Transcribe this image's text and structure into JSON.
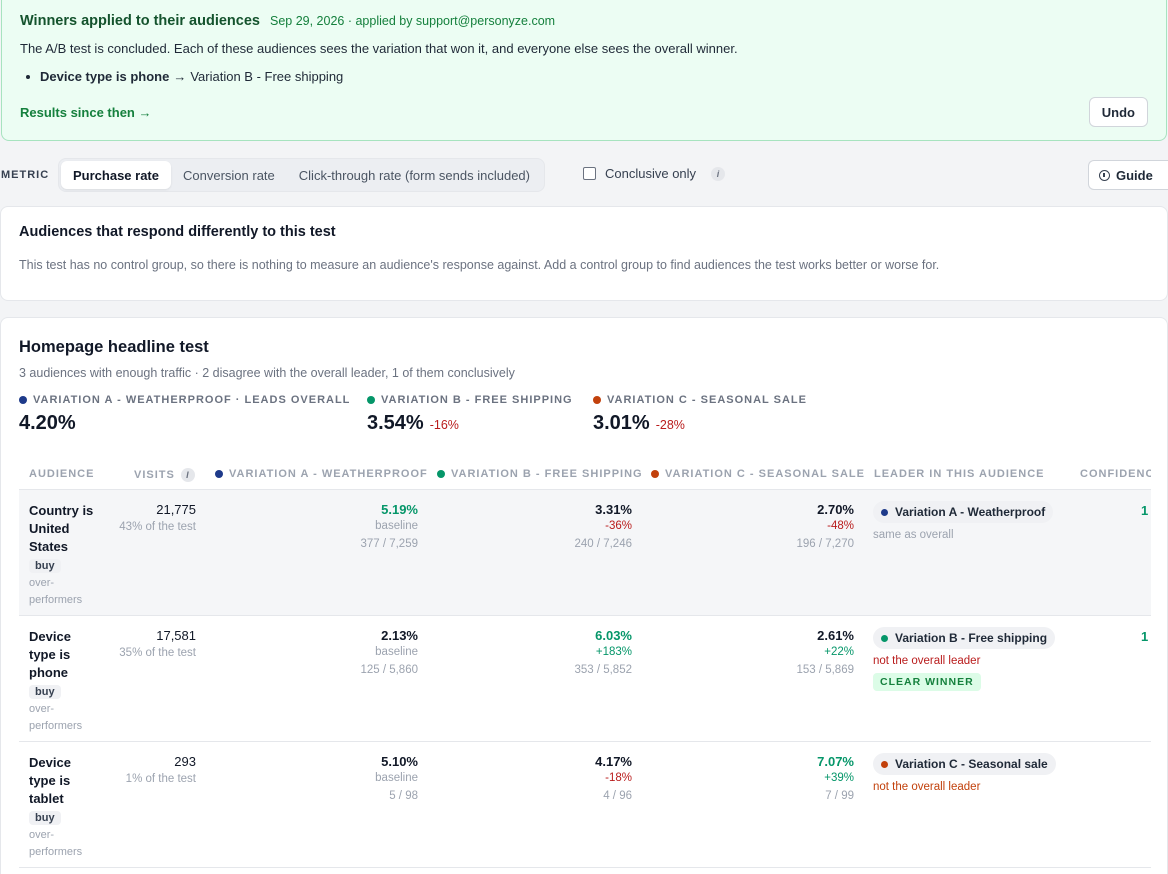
{
  "colors": {
    "varA": "#1e3a8a",
    "varB": "#059669",
    "varC": "#c2410c"
  },
  "banner": {
    "title": "Winners applied to their audiences",
    "meta": "Sep 29, 2026 · applied by support@personyze.com",
    "description": "The A/B test is concluded. Each of these audiences sees the variation that won it, and everyone else sees the overall winner.",
    "item_audience": "Device type is phone",
    "item_arrow": "→",
    "item_variation": "Variation B - Free shipping",
    "results_link": "Results since then →",
    "undo_label": "Undo"
  },
  "metric": {
    "label": "METRIC",
    "options": [
      "Purchase rate",
      "Conversion rate",
      "Click-through rate (form sends included)"
    ],
    "selected": "Purchase rate",
    "conclusive_label": "Conclusive only",
    "info": "i",
    "guide_label": "Guide"
  },
  "audiences_card": {
    "title": "Audiences that respond differently to this test",
    "text": "This test has no control group, so there is nothing to measure an audience's response against. Add a control group to find audiences the test works better or worse for."
  },
  "test": {
    "title": "Homepage headline test",
    "subtitle": "3 audiences with enough traffic · 2 disagree with the overall leader, 1 of them conclusively",
    "overall": [
      {
        "label": "Variation A - Weatherproof · leads overall",
        "value": "4.20%",
        "delta": ""
      },
      {
        "label": "Variation B - Free shipping",
        "value": "3.54%",
        "delta": "-16%"
      },
      {
        "label": "Variation C - Seasonal sale",
        "value": "3.01%",
        "delta": "-28%"
      }
    ],
    "columns": {
      "audience": "Audience",
      "visits": "Visits",
      "info": "i",
      "varA": "Variation A - Weatherproof",
      "varB": "Variation B - Free shipping",
      "varC": "Variation C - Seasonal sale",
      "leader": "Leader in this audience",
      "confidence": "Confidenc"
    },
    "rows": [
      {
        "name": "Country is United States",
        "tag": "buy",
        "note": "over-performers",
        "visits": "21,775",
        "share": "43% of the test",
        "a": {
          "rate": "5.19%",
          "delta": "baseline",
          "counts": "377 / 7,259"
        },
        "b": {
          "rate": "3.31%",
          "delta": "-36%",
          "counts": "240 / 7,246"
        },
        "c": {
          "rate": "2.70%",
          "delta": "-48%",
          "counts": "196 / 7,270"
        },
        "leader": "Variation A - Weatherproof",
        "leader_note": "same as overall",
        "badge": "",
        "confidence": "1"
      },
      {
        "name": "Device type is phone",
        "tag": "buy",
        "note": "over-performers",
        "visits": "17,581",
        "share": "35% of the test",
        "a": {
          "rate": "2.13%",
          "delta": "baseline",
          "counts": "125 / 5,860"
        },
        "b": {
          "rate": "6.03%",
          "delta": "+183%",
          "counts": "353 / 5,852"
        },
        "c": {
          "rate": "2.61%",
          "delta": "+22%",
          "counts": "153 / 5,869"
        },
        "leader": "Variation B - Free shipping",
        "leader_note": "not the overall leader",
        "badge": "CLEAR WINNER",
        "confidence": "1"
      },
      {
        "name": "Device type is tablet",
        "tag": "buy",
        "note": "over-performers",
        "visits": "293",
        "share": "1% of the test",
        "a": {
          "rate": "5.10%",
          "delta": "baseline",
          "counts": "5 / 98"
        },
        "b": {
          "rate": "4.17%",
          "delta": "-18%",
          "counts": "4 / 96"
        },
        "c": {
          "rate": "7.07%",
          "delta": "+39%",
          "counts": "7 / 99"
        },
        "leader": "Variation C - Seasonal sale",
        "leader_note": "not the overall leader",
        "badge": "",
        "confidence": ""
      }
    ]
  }
}
